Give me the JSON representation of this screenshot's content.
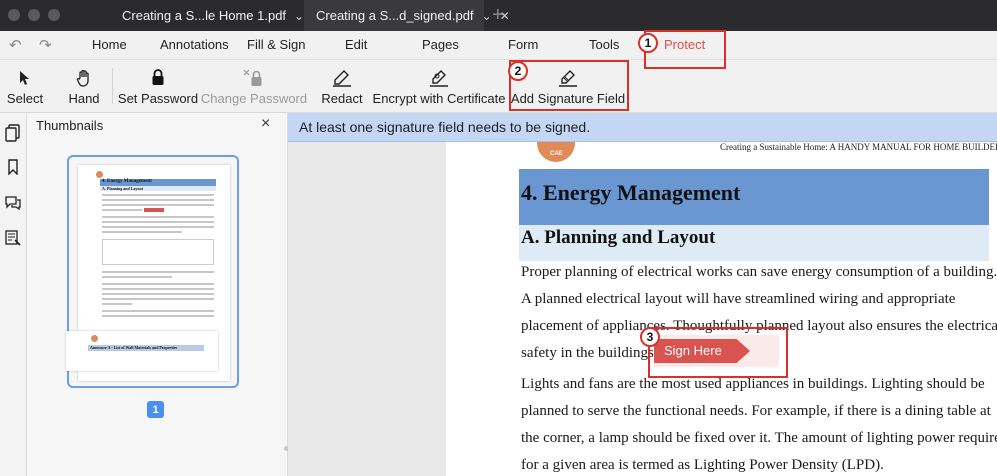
{
  "window": {
    "tabs": [
      {
        "label": "Creating a S...le Home 1.pdf",
        "active": false
      },
      {
        "label": "Creating a S...d_signed.pdf",
        "active": true
      }
    ],
    "new_tab": "+"
  },
  "menu": {
    "items": [
      "Home",
      "Annotations",
      "Fill & Sign",
      "Edit",
      "Pages",
      "Form",
      "Tools",
      "Protect"
    ],
    "active": "Protect",
    "accent_color": "#e0524a"
  },
  "toolbar": {
    "tools": [
      {
        "label": "Select",
        "icon": "arrow-cursor-icon",
        "enabled": true
      },
      {
        "label": "Hand",
        "icon": "hand-icon",
        "enabled": true
      },
      {
        "label": "Set Password",
        "icon": "lock-icon",
        "enabled": true
      },
      {
        "label": "Change Password",
        "icon": "lock-cross-icon",
        "enabled": false
      },
      {
        "label": "Redact",
        "icon": "redact-pen-icon",
        "enabled": true
      },
      {
        "label": "Encrypt with Certificate",
        "icon": "certificate-pen-icon",
        "enabled": true
      },
      {
        "label": "Add Signature Field",
        "icon": "signature-field-icon",
        "enabled": true
      }
    ]
  },
  "sidebar": {
    "rail_icons": [
      "pages-icon",
      "bookmark-icon",
      "comments-icon",
      "fields-icon"
    ],
    "title": "Thumbnails",
    "close": "×",
    "current_page": "1",
    "thumb_heading": "4. Energy Management",
    "thumb_subheading": "A. Planning and Layout",
    "thumb2_heading": "Annexure A - List of Wall Materials and Properties"
  },
  "banner": {
    "text": "At least one signature field needs to be signed."
  },
  "document": {
    "header": "Creating a Sustainable Home: A HANDY MANUAL FOR HOME BUILDERS",
    "logo_text": "CAE",
    "heading": "4.   Energy Management",
    "subheading": "A.   Planning and Layout",
    "lines": [
      "Proper planning of electrical works can save energy consumption of a building.",
      "A  planned  electrical  layout  will  have  streamlined  wiring  and  appropriate",
      "placement of appliances. Thoughtfully planned layout also ensures the electrical",
      "safety in the buildings.",
      "Lights and fans are the most used appliances in buildings. Lighting should be",
      "planned to serve the functional needs. For example, if there is a dining table at",
      "the corner, a lamp should be fixed over it. The amount of lighting power required",
      "for a given area is termed as Lighting Power Density (LPD)."
    ],
    "sign_here": "Sign Here"
  },
  "callouts": [
    "1",
    "2",
    "3"
  ],
  "colors": {
    "highlight": "#d9302b",
    "heading_bar": "#6a96d2",
    "subheading_bar": "#deeaf6",
    "banner": "#c3d6f4",
    "sign_tag": "#d9534f"
  }
}
